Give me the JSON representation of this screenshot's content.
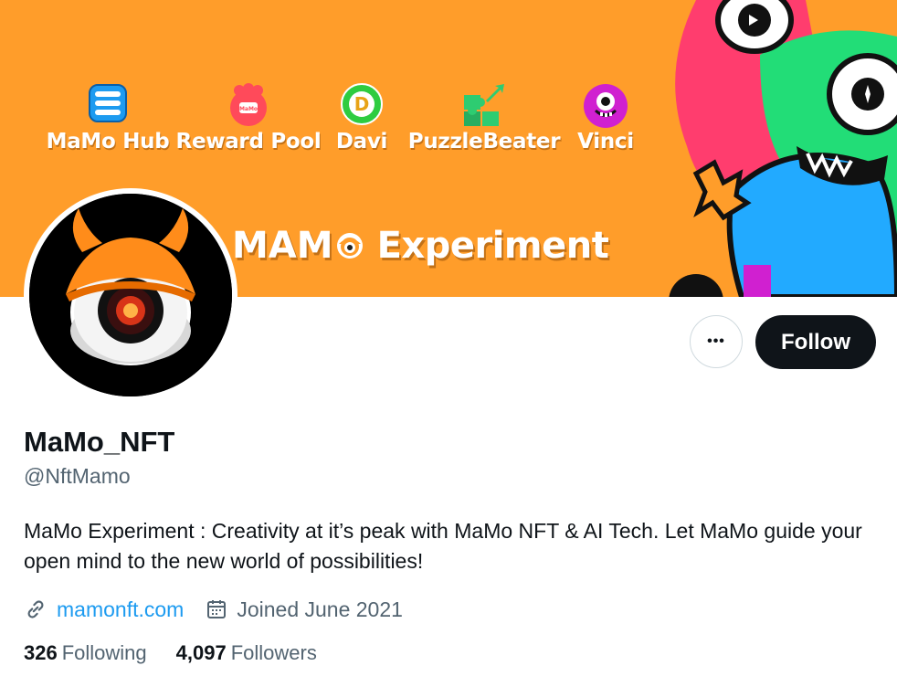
{
  "banner": {
    "background": "#ff9d2a",
    "apps": [
      {
        "label": "MaMo Hub",
        "icon": "hub-icon",
        "color": "#1d9bf0"
      },
      {
        "label": "Reward Pool",
        "icon": "reward-pool-icon",
        "color": "#ff4a5a"
      },
      {
        "label": "Davi",
        "icon": "davi-icon",
        "color": "#2ecc40"
      },
      {
        "label": "PuzzleBeater",
        "icon": "puzzle-icon",
        "color": "#2ecc71"
      },
      {
        "label": "Vinci",
        "icon": "vinci-icon",
        "color": "#d020d0"
      }
    ],
    "title_prefix": "MAM",
    "title_suffix": "Experiment"
  },
  "profile": {
    "display_name": "MaMo_NFT",
    "handle": "@NftMamo",
    "bio": "MaMo Experiment : Creativity at it’s peak with MaMo NFT & AI Tech. Let MaMo guide your open mind to the new world of possibilities!",
    "website": "mamonft.com",
    "joined": "Joined June 2021",
    "following_count": "326",
    "following_label": "Following",
    "followers_count": "4,097",
    "followers_label": "Followers"
  },
  "actions": {
    "more_label": "•••",
    "follow_label": "Follow"
  },
  "colors": {
    "accent": "#1d9bf0",
    "follow_button": "#0f1419",
    "secondary_text": "#536471"
  }
}
